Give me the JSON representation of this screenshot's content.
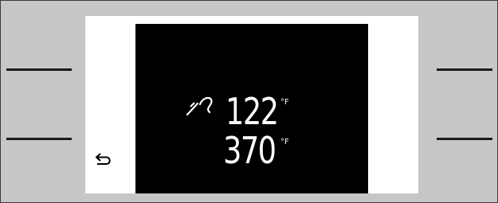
{
  "display": {
    "probe_temperature": {
      "value": "122",
      "unit": "°F",
      "icon": "meat-probe-icon"
    },
    "oven_temperature": {
      "value": "370",
      "unit": "°F"
    }
  },
  "controls": {
    "back_icon": "back-arrow-icon"
  },
  "colors": {
    "housing": "#c6c6c6",
    "panel": "#ffffff",
    "screen": "#000000",
    "text": "#ffffff"
  }
}
